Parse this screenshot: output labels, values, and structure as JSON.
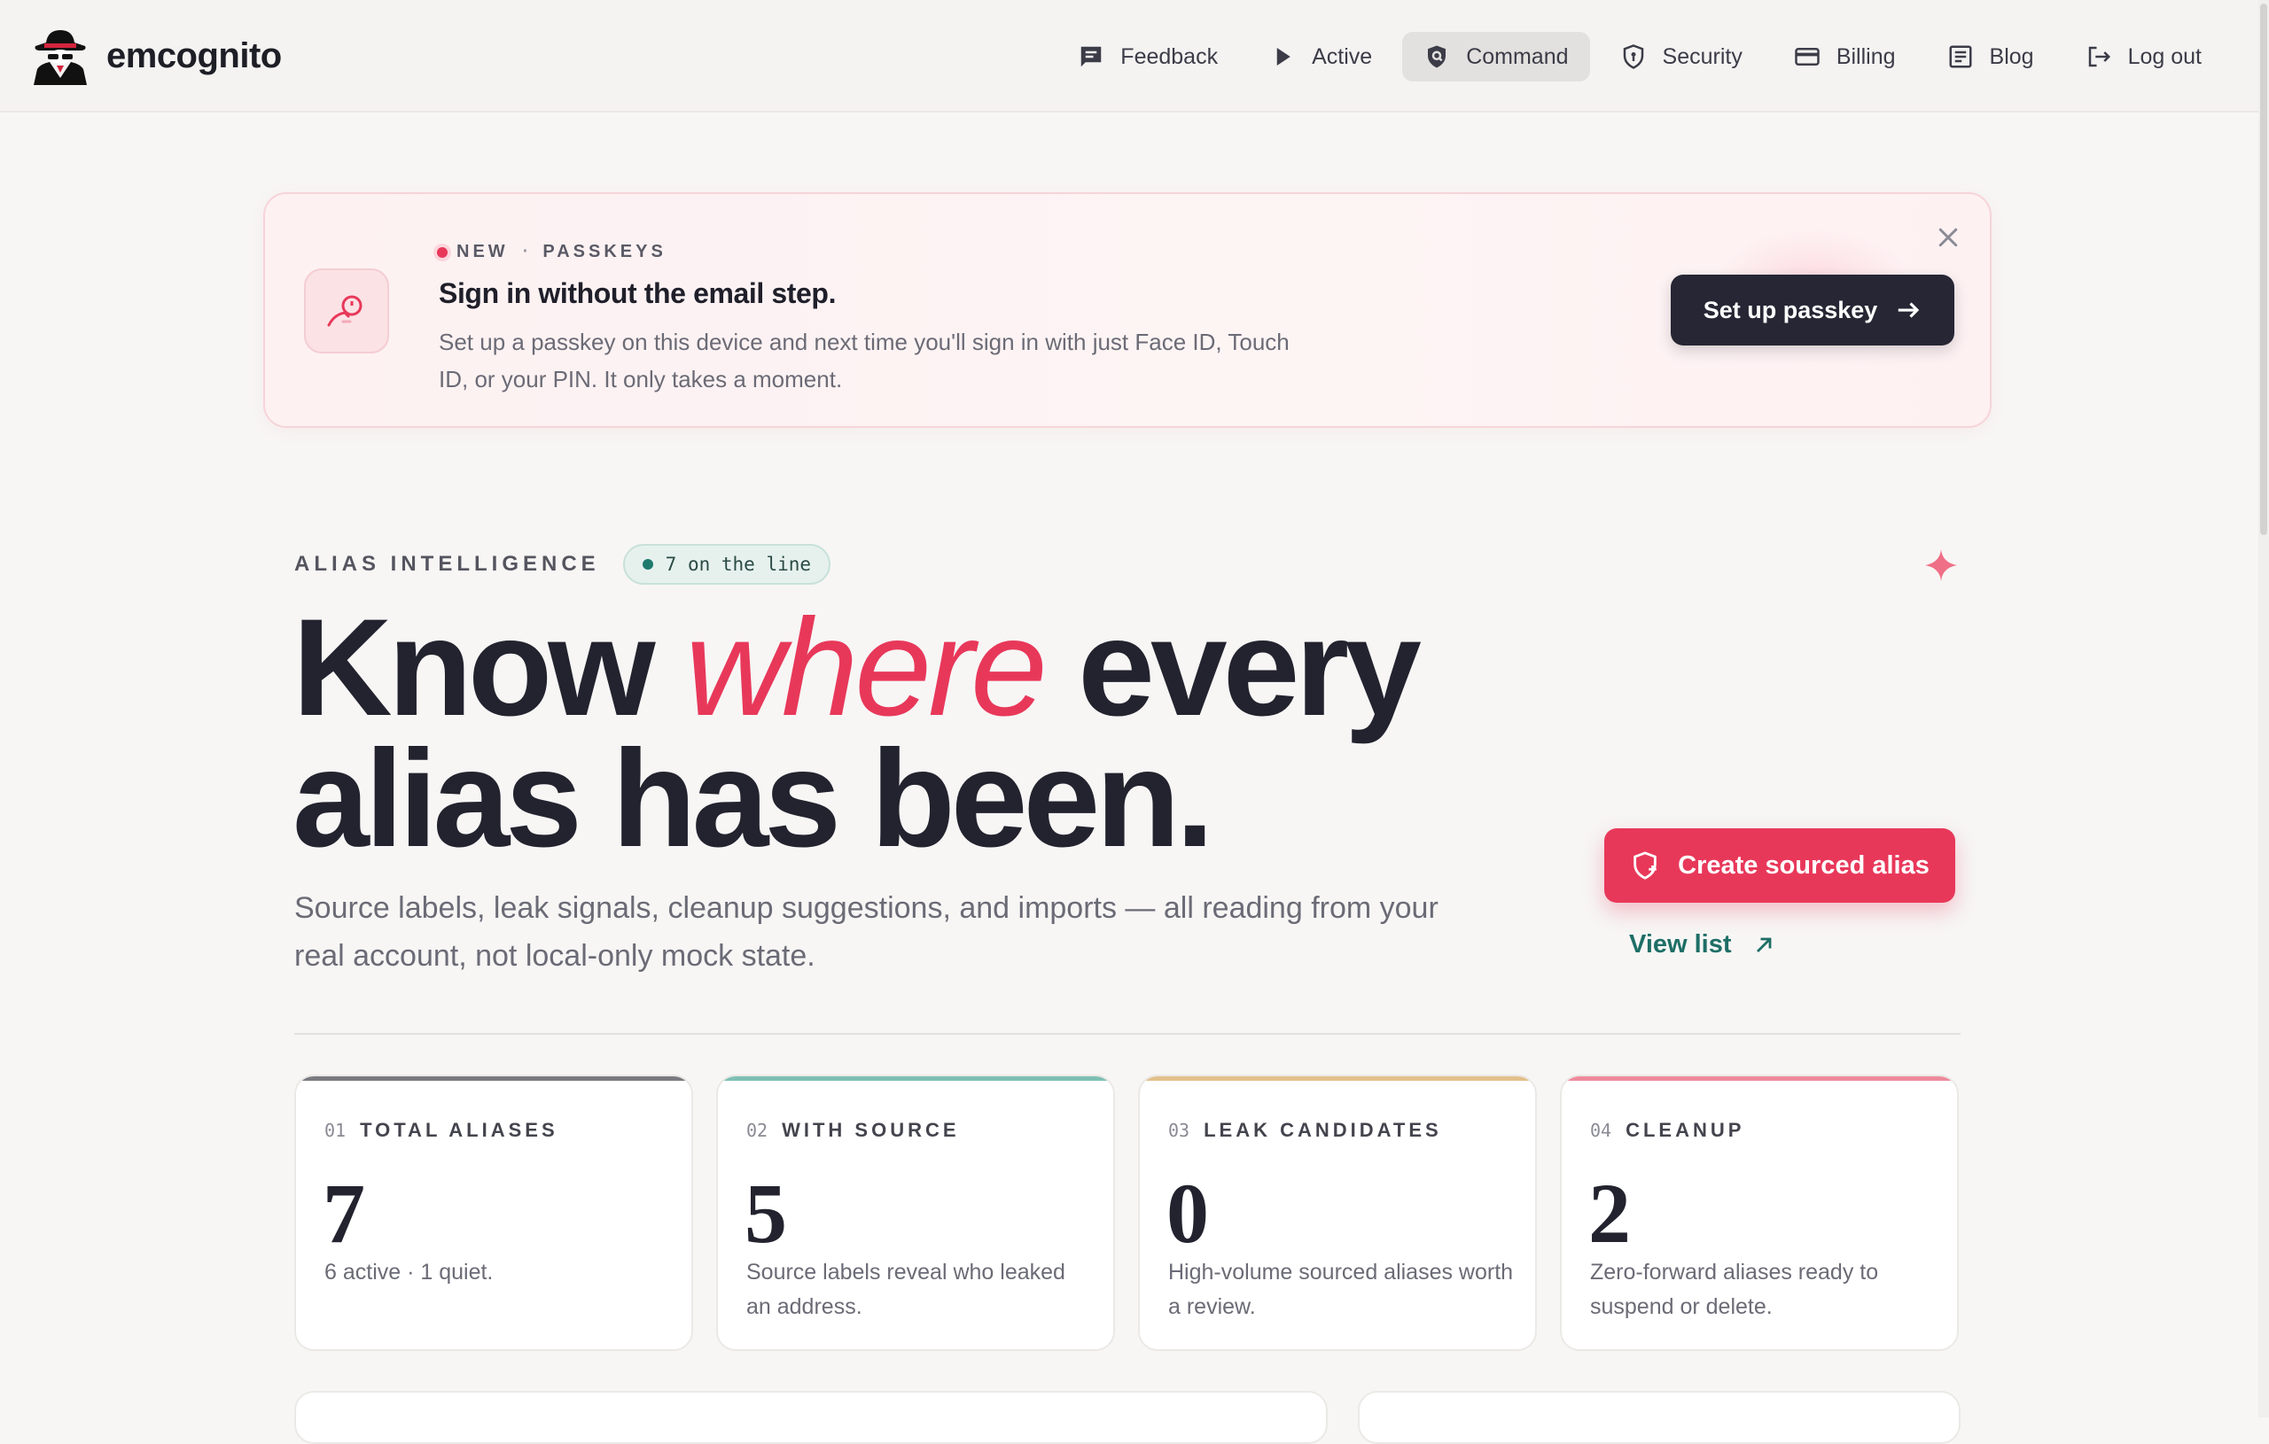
{
  "brand": {
    "name": "emcognito"
  },
  "nav": {
    "items": [
      {
        "label": "Feedback",
        "icon": "feedback-icon"
      },
      {
        "label": "Active",
        "icon": "play-icon"
      },
      {
        "label": "Command",
        "icon": "command-shield-icon",
        "active": true
      },
      {
        "label": "Security",
        "icon": "security-shield-icon"
      },
      {
        "label": "Billing",
        "icon": "card-icon"
      },
      {
        "label": "Blog",
        "icon": "blog-icon"
      },
      {
        "label": "Log out",
        "icon": "logout-icon"
      }
    ]
  },
  "banner": {
    "tag": "NEW",
    "sep": "·",
    "topic": "PASSKEYS",
    "title": "Sign in without the email step.",
    "body": "Set up a passkey on this device and next time you'll sign in with just Face ID, Touch ID, or your PIN. It only takes a moment.",
    "cta_label": "Set up passkey"
  },
  "hero": {
    "eyebrow": "ALIAS INTELLIGENCE",
    "pill": "7 on the line",
    "title_part1": "Know ",
    "title_accent": "where",
    "title_part2": " every alias has been.",
    "subtitle": "Source labels, leak signals, cleanup suggestions, and imports — all reading from your real account, not local-only mock state.",
    "primary_cta": "Create sourced alias",
    "secondary_cta": "View list"
  },
  "stats": [
    {
      "num": "01",
      "label": "TOTAL ALIASES",
      "value": "7",
      "desc": "6 active · 1 quiet.",
      "color": "#7a7a80"
    },
    {
      "num": "02",
      "label": "WITH SOURCE",
      "value": "5",
      "desc": "Source labels reveal who leaked an address.",
      "color": "#7fbfb4"
    },
    {
      "num": "03",
      "label": "LEAK CANDIDATES",
      "value": "0",
      "desc": "High-volume sourced aliases worth a review.",
      "color": "#e2c08a"
    },
    {
      "num": "04",
      "label": "CLEANUP",
      "value": "2",
      "desc": "Zero-forward aliases ready to suspend or delete.",
      "color": "#ee8a9c"
    }
  ],
  "colors": {
    "accent": "#e8385a",
    "dark": "#262634",
    "teal": "#1e6e66",
    "background": "#f7f6f5"
  }
}
